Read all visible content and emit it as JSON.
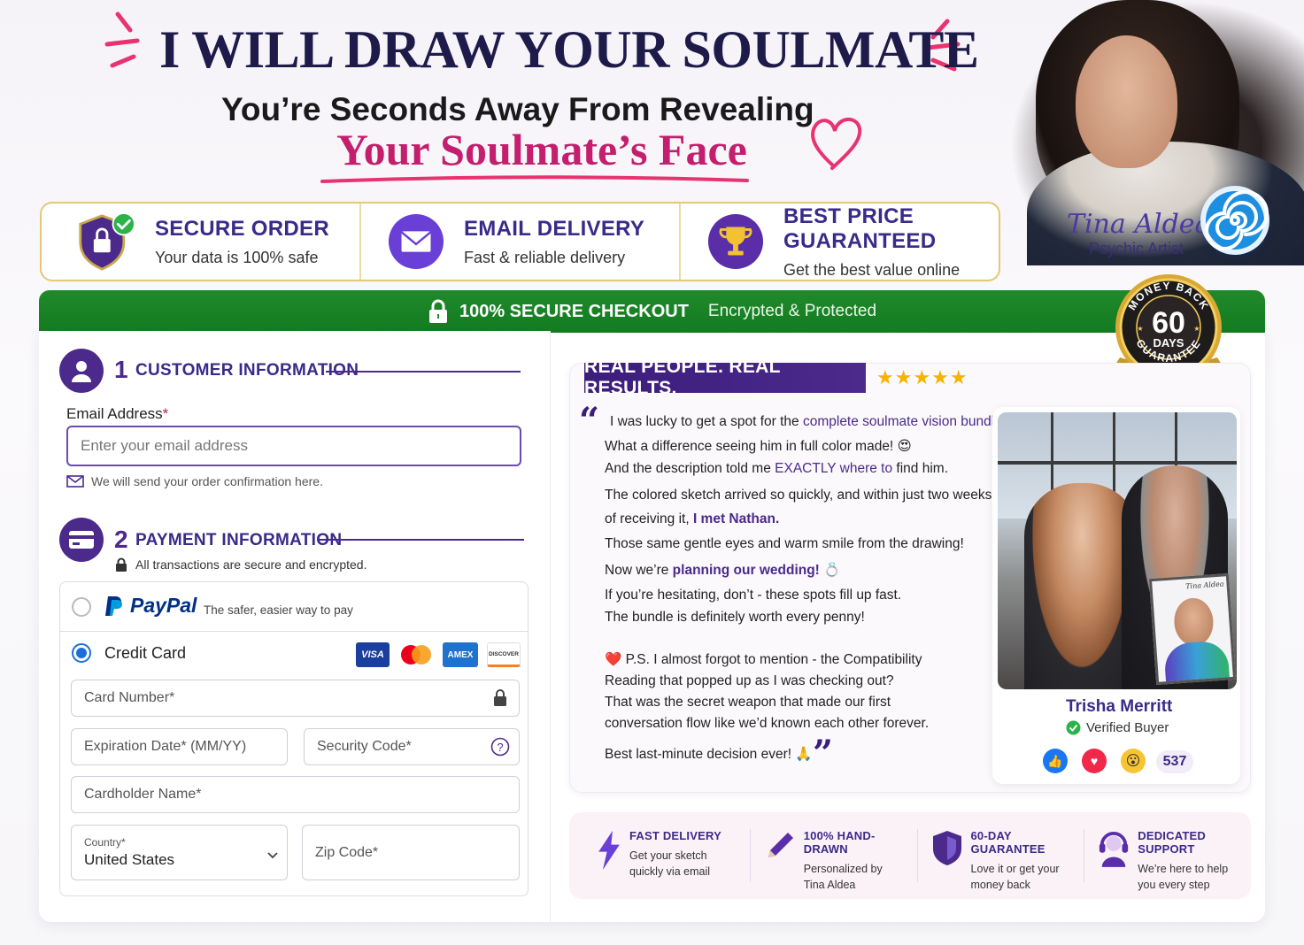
{
  "header": {
    "headline": "I WILL DRAW YOUR SOULMATE",
    "subline": "You’re Seconds Away From Revealing",
    "subline_highlight": "Your Soulmate’s Face"
  },
  "artist": {
    "name": "Tina Aldea",
    "role": "Psychic Artist"
  },
  "trust": [
    {
      "title": "SECURE ORDER",
      "sub": "Your data is 100% safe",
      "icon": "shield-lock-icon"
    },
    {
      "title": "EMAIL DELIVERY",
      "sub": "Fast & reliable delivery",
      "icon": "envelope-icon"
    },
    {
      "title": "BEST PRICE GUARANTEED",
      "sub": "Get the best value online",
      "icon": "trophy-icon"
    }
  ],
  "secure_bar": {
    "main": "100% SECURE CHECKOUT",
    "sub": "Encrypted & Protected"
  },
  "seal": {
    "top": "MONEY BACK",
    "number": "60",
    "days": "DAYS",
    "bottom": "GUARANTEE"
  },
  "customer": {
    "step": "1",
    "title": "CUSTOMER INFORMATION",
    "email_label": "Email Address",
    "email_placeholder": "Enter your email address",
    "email_hint": "We will send your order confirmation here."
  },
  "payment": {
    "step": "2",
    "title": "PAYMENT INFORMATION",
    "secure_note": "All transactions are secure and encrypted.",
    "paypal_name": "PayPal",
    "paypal_tagline": "The safer, easier way to pay",
    "credit_card_label": "Credit Card",
    "card_brands": [
      "VISA",
      "",
      "AMEX",
      "DISCOVER"
    ],
    "card_number_placeholder": "Card Number*",
    "expiration_placeholder": "Expiration Date* (MM/YY)",
    "security_code_placeholder": "Security Code*",
    "cardholder_placeholder": "Cardholder Name*",
    "country_label": "Country*",
    "country_value": "United States",
    "zip_placeholder": "Zip Code*"
  },
  "testimonial": {
    "ribbon": "REAL PEOPLE. REAL RESULTS.",
    "stars": "★★★★★",
    "lines": [
      {
        "pre": "I was lucky to get a spot for the ",
        "hl": "complete soulmate vision bundle.",
        "post": ""
      },
      {
        "pre": "What a difference seeing him in full color made! 😍",
        "hl": "",
        "post": ""
      },
      {
        "pre": "And the description told me ",
        "hl": "EXACTLY where to",
        "post": " find him."
      },
      {
        "pre": "The colored sketch arrived so quickly, and within just two weeks",
        "hl": "",
        "post": ""
      },
      {
        "pre": "of receiving it, ",
        "hl": "I met Nathan.",
        "post": ""
      },
      {
        "pre": "Those same gentle eyes and warm smile from the drawing!",
        "hl": "",
        "post": ""
      },
      {
        "pre": "Now we’re ",
        "hl": "planning our wedding!",
        "post": " 💍"
      },
      {
        "pre": "If you’re hesitating, don’t - these spots fill up fast.",
        "hl": "",
        "post": ""
      },
      {
        "pre": "The bundle is definitely worth every penny!",
        "hl": "",
        "post": ""
      },
      {
        "pre": "❤️ P.S. I almost forgot to mention - the Compatibility",
        "hl": "",
        "post": ""
      },
      {
        "pre": "Reading that popped up as I was checking out?",
        "hl": "",
        "post": ""
      },
      {
        "pre": "That was the secret weapon that made our first",
        "hl": "",
        "post": ""
      },
      {
        "pre": "conversation flow like we’d known each other forever.",
        "hl": "",
        "post": ""
      },
      {
        "pre": "Best last-minute decision ever! 🙏",
        "hl": "",
        "post": ""
      }
    ],
    "reviewer_name": "Trisha Merritt",
    "verified": "Verified Buyer",
    "reaction_count": "537",
    "photo_tag": "Tina Aldea"
  },
  "features": [
    {
      "title": "FAST DELIVERY",
      "sub1": "Get your sketch",
      "sub2": "quickly via email",
      "icon": "lightning-icon"
    },
    {
      "title": "100% HAND-DRAWN",
      "sub1": "Personalized by",
      "sub2": "Tina Aldea",
      "icon": "pencil-icon"
    },
    {
      "title": "60-DAY GUARANTEE",
      "sub1": "Love it or get your",
      "sub2": "money back",
      "icon": "shield-icon"
    },
    {
      "title": "DEDICATED SUPPORT",
      "sub1": "We’re here to help",
      "sub2": "you every step",
      "icon": "headset-icon"
    }
  ],
  "colors": {
    "brand_purple": "#3a2a8a",
    "accent_pink": "#c41e6e",
    "secure_green": "#1f8a2b",
    "gold": "#e6c774"
  }
}
